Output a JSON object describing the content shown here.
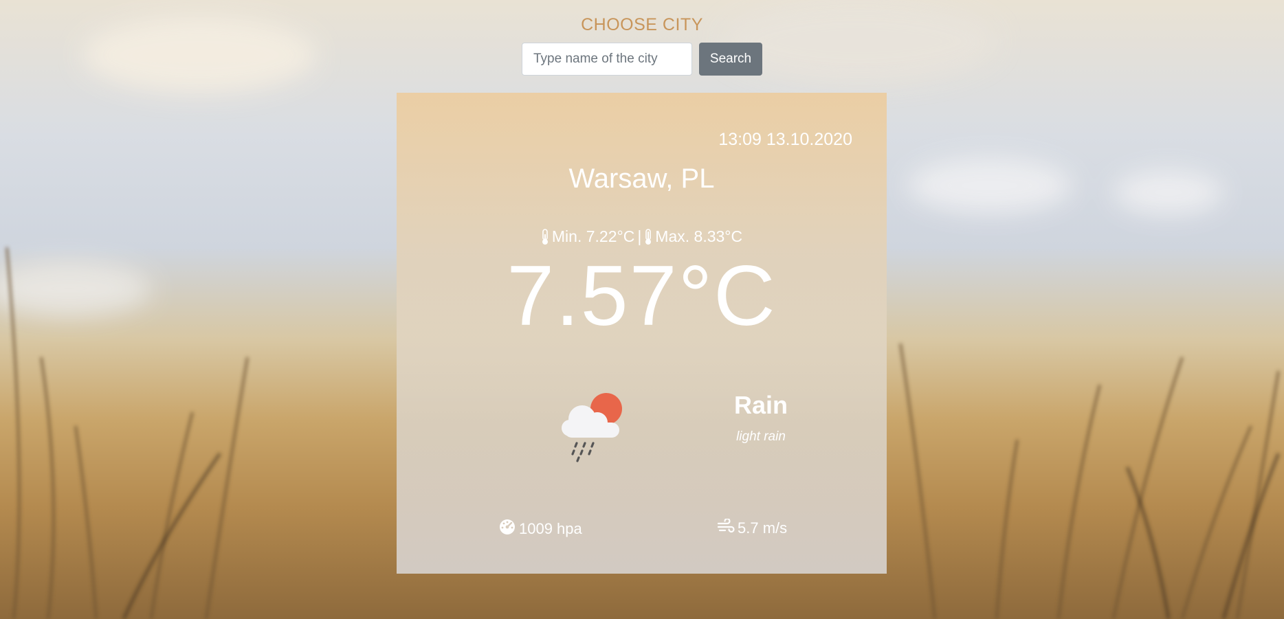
{
  "header": {
    "title": "CHOOSE CITY"
  },
  "search": {
    "placeholder": "Type name of the city",
    "value": "",
    "button_label": "Search"
  },
  "weather": {
    "datetime": "13:09 13.10.2020",
    "city": "Warsaw, PL",
    "min_label": "Min. 7.22°C",
    "separator": "|",
    "max_label": "Max. 8.33°C",
    "temperature": "7.57°C",
    "condition": "Rain",
    "description": "light rain",
    "icon": "rain-cloud-sun-icon",
    "pressure": "1009 hpa",
    "wind": "5.7 m/s"
  },
  "colors": {
    "title": "#c8955a",
    "button": "#6c757d",
    "sun": "#e8664a",
    "text": "#ffffff"
  }
}
